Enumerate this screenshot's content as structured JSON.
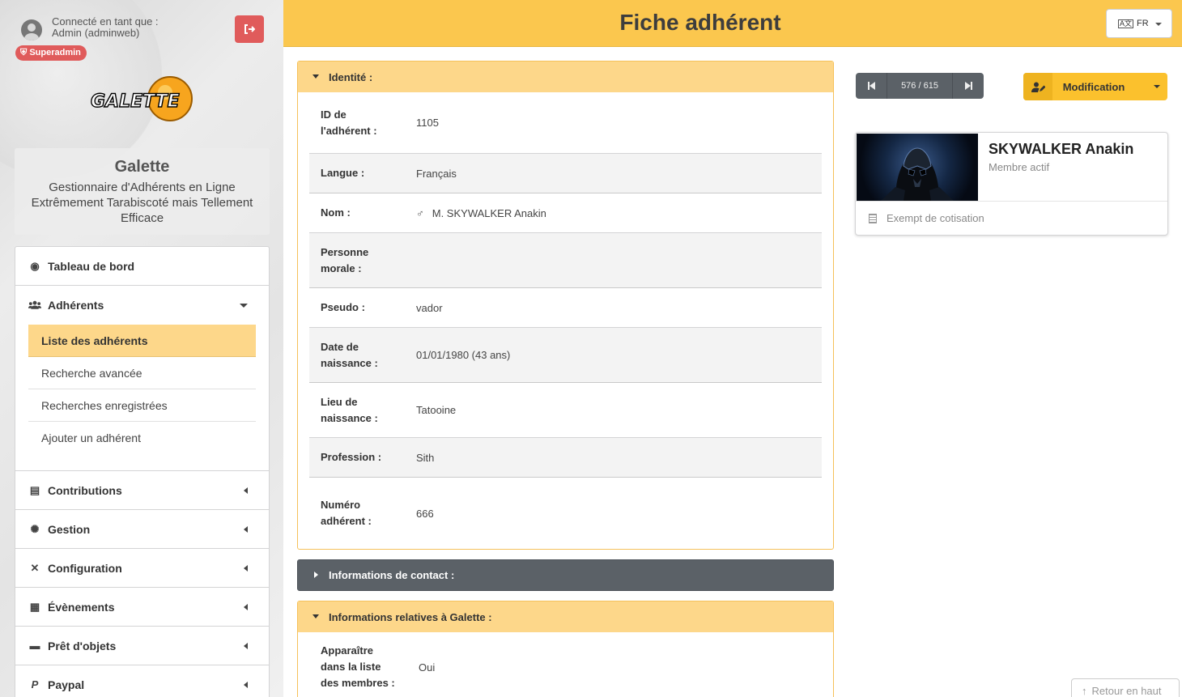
{
  "user": {
    "connected_as": "Connecté en tant que :",
    "name": "Admin (adminweb)",
    "badge": "Superadmin"
  },
  "app": {
    "logo_text": "GALETTE",
    "title": "Galette",
    "subtitle": "Gestionnaire d'Adhérents en Ligne Extrêmement Tarabiscoté mais Tellement Efficace"
  },
  "menu": {
    "dashboard": "Tableau de bord",
    "members": "Adhérents",
    "members_sub": [
      "Liste des adhérents",
      "Recherche avancée",
      "Recherches enregistrées",
      "Ajouter un adhérent"
    ],
    "contributions": "Contributions",
    "management": "Gestion",
    "configuration": "Configuration",
    "events": "Évènements",
    "loans": "Prêt d'objets",
    "paypal": "Paypal"
  },
  "header": {
    "title": "Fiche adhérent",
    "lang": "FR"
  },
  "identity": {
    "heading": "Identité :",
    "fields": [
      {
        "label": "ID de l'adhérent :",
        "value": "1105"
      },
      {
        "label": "Langue :",
        "value": "Français"
      },
      {
        "label": "Nom :",
        "value": "M. SKYWALKER Anakin"
      },
      {
        "label": "Personne morale :",
        "value": ""
      },
      {
        "label": "Pseudo :",
        "value": "vador"
      },
      {
        "label": "Date de naissance :",
        "value": "01/01/1980 (43 ans)"
      },
      {
        "label": "Lieu de naissance :",
        "value": "Tatooine"
      },
      {
        "label": "Profession :",
        "value": "Sith"
      },
      {
        "label": "Numéro adhérent :",
        "value": "666"
      }
    ]
  },
  "contact": {
    "heading": "Informations de contact :"
  },
  "galette_info": {
    "heading": "Informations relatives à Galette :",
    "fields": [
      {
        "label": "Apparaître dans la liste des membres :",
        "value": "Oui"
      }
    ]
  },
  "pager": {
    "count": "576 / 615"
  },
  "edit_button": "Modification",
  "card": {
    "name": "SKYWALKER Anakin",
    "status": "Membre actif",
    "footer": "Exempt de cotisation"
  },
  "back_to_top": "Retour en haut",
  "icons": {
    "user": "user-circle-icon",
    "logout": "logout-icon",
    "shield": "shield-icon",
    "dashboard": "compass-icon",
    "members": "users-icon",
    "contributions": "receipt-icon",
    "management": "cog-icon",
    "configuration": "tools-icon",
    "events": "calendar-icon",
    "loans": "briefcase-icon",
    "paypal": "paypal-icon"
  },
  "colors": {
    "accent": "#fbc74e",
    "accent_light": "#fdd78a",
    "dark": "#5b6167",
    "danger": "#e05b5b"
  }
}
